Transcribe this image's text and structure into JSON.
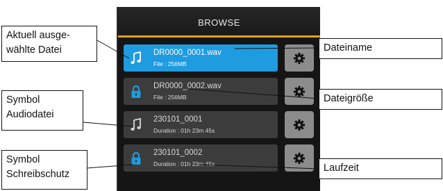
{
  "screen": {
    "title": "BROWSE",
    "files": [
      {
        "name": "DR0000_0001.wav",
        "info": "File : 256MB",
        "icon": "music-note-icon",
        "selected": true
      },
      {
        "name": "DR0000_0002.wav",
        "info": "File : 256MB",
        "icon": "lock-icon",
        "selected": false
      },
      {
        "name": "230101_0001",
        "info": "Duration : 01h 23m 45s",
        "icon": "music-note-icon",
        "selected": false
      },
      {
        "name": "230101_0002",
        "info": "Duration : 01h 23m 45s",
        "icon": "lock-icon",
        "selected": false
      }
    ]
  },
  "callouts": {
    "left": [
      {
        "line1": "Aktuell ausge-",
        "line2": "wählte Datei"
      },
      {
        "line1": "Symbol",
        "line2": "Audiodatei"
      },
      {
        "line1": "Symbol",
        "line2": "Schreibschutz"
      }
    ],
    "right": [
      {
        "text": "Dateiname"
      },
      {
        "text": "Dateigröße"
      },
      {
        "text": "Laufzeit"
      }
    ]
  },
  "colors": {
    "accent": "#e1a21a",
    "selected": "#1f9be0",
    "row": "#3c3c3c",
    "gear_button": "#8c8c8c"
  }
}
